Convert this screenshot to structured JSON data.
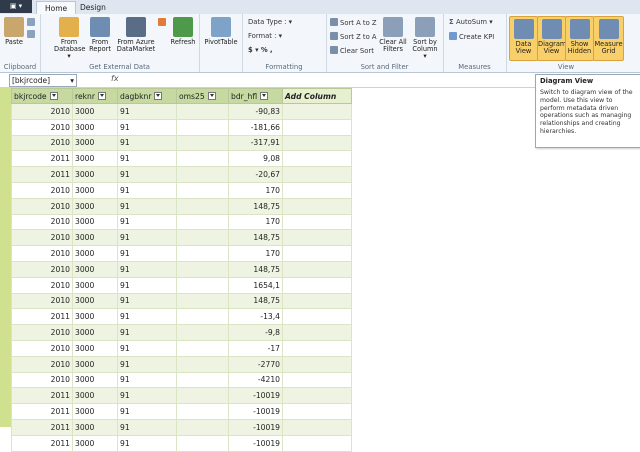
{
  "tabs": {
    "app": "",
    "home": "Home",
    "design": "Design"
  },
  "ribbon": {
    "clipboard": {
      "label": "Clipboard",
      "paste": "Paste"
    },
    "external": {
      "label": "Get External Data",
      "from_database": "From Database ▾",
      "from_report": "From Report",
      "from_azure": "From Azure DataMarket",
      "refresh": "Refresh"
    },
    "pivot": {
      "label": "PivotTable"
    },
    "formatting": {
      "label": "Formatting",
      "data_type": "Data Type :",
      "format": "Format :",
      "currency": "$ ▾ % ,"
    },
    "sort": {
      "label": "Sort and Filter",
      "sort_az": "Sort A to Z",
      "sort_za": "Sort Z to A",
      "clear_sort": "Clear Sort",
      "clear_filters": "Clear All Filters",
      "sort_by_column": "Sort by Column ▾"
    },
    "measures": {
      "label": "Measures",
      "autosum": "AutoSum ▾",
      "create_kpi": "Create KPI"
    },
    "view": {
      "label": "View",
      "data_view": "Data View",
      "diagram_view": "Diagram View",
      "show_hidden": "Show Hidden",
      "measure_grid": "Measure Grid"
    }
  },
  "formula_bar": {
    "name_box": "[bkjrcode]",
    "fx": "fx"
  },
  "tooltip": {
    "title": "Diagram View",
    "body": "Switch to diagram view of the model. Use this view to perform metadata driven operations such as managing relationships and creating hierarchies."
  },
  "table": {
    "columns": [
      "bkjrcode",
      "reknr",
      "dagbknr",
      "oms25",
      "bdr_hfl",
      "Add Column"
    ],
    "rows": [
      [
        "2010",
        "3000",
        "91",
        "",
        "-90,83"
      ],
      [
        "2010",
        "3000",
        "91",
        "",
        "-181,66"
      ],
      [
        "2010",
        "3000",
        "91",
        "",
        "-317,91"
      ],
      [
        "2011",
        "3000",
        "91",
        "",
        "9,08"
      ],
      [
        "2011",
        "3000",
        "91",
        "",
        "-20,67"
      ],
      [
        "2010",
        "3000",
        "91",
        "",
        "170"
      ],
      [
        "2010",
        "3000",
        "91",
        "",
        "148,75"
      ],
      [
        "2010",
        "3000",
        "91",
        "",
        "170"
      ],
      [
        "2010",
        "3000",
        "91",
        "",
        "148,75"
      ],
      [
        "2010",
        "3000",
        "91",
        "",
        "170"
      ],
      [
        "2010",
        "3000",
        "91",
        "",
        "148,75"
      ],
      [
        "2010",
        "3000",
        "91",
        "",
        "1654,1"
      ],
      [
        "2010",
        "3000",
        "91",
        "",
        "148,75"
      ],
      [
        "2011",
        "3000",
        "91",
        "",
        "-13,4"
      ],
      [
        "2010",
        "3000",
        "91",
        "",
        "-9,8"
      ],
      [
        "2010",
        "3000",
        "91",
        "",
        "-17"
      ],
      [
        "2010",
        "3000",
        "91",
        "",
        "-2770"
      ],
      [
        "2010",
        "3000",
        "91",
        "",
        "-4210"
      ],
      [
        "2011",
        "3000",
        "91",
        "",
        "-10019"
      ],
      [
        "2011",
        "3000",
        "91",
        "",
        "-10019"
      ],
      [
        "2011",
        "3000",
        "91",
        "",
        "-10019"
      ],
      [
        "2011",
        "3000",
        "91",
        "",
        "-10019"
      ]
    ]
  }
}
